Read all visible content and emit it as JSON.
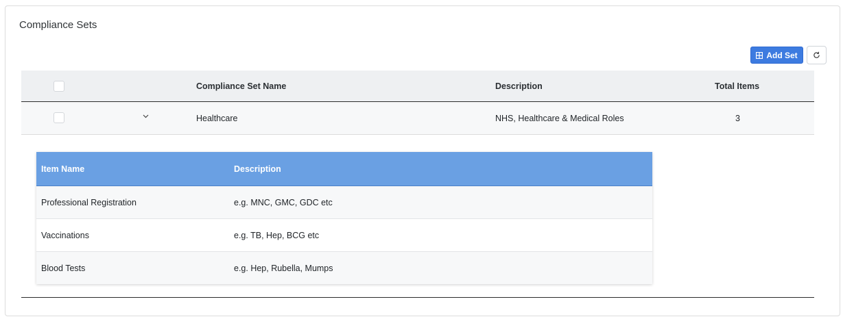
{
  "card": {
    "title": "Compliance Sets"
  },
  "toolbar": {
    "add_label": "Add Set"
  },
  "main_table": {
    "headers": {
      "name": "Compliance Set Name",
      "description": "Description",
      "total": "Total Items"
    },
    "rows": [
      {
        "name": "Healthcare",
        "description": "NHS, Healthcare & Medical Roles",
        "total": "3"
      }
    ]
  },
  "sub_table": {
    "headers": {
      "item_name": "Item Name",
      "description": "Description"
    },
    "rows": [
      {
        "item_name": "Professional Registration",
        "description": "e.g. MNC, GMC, GDC etc"
      },
      {
        "item_name": "Vaccinations",
        "description": "e.g. TB, Hep, BCG etc"
      },
      {
        "item_name": "Blood Tests",
        "description": "e.g. Hep, Rubella, Mumps"
      }
    ]
  },
  "icons": {
    "add": "grid-plus-icon",
    "refresh": "refresh-icon",
    "expand": "chevron-down-icon"
  },
  "colors": {
    "primary": "#3d7be0",
    "sub_header": "#6aa0e3"
  }
}
